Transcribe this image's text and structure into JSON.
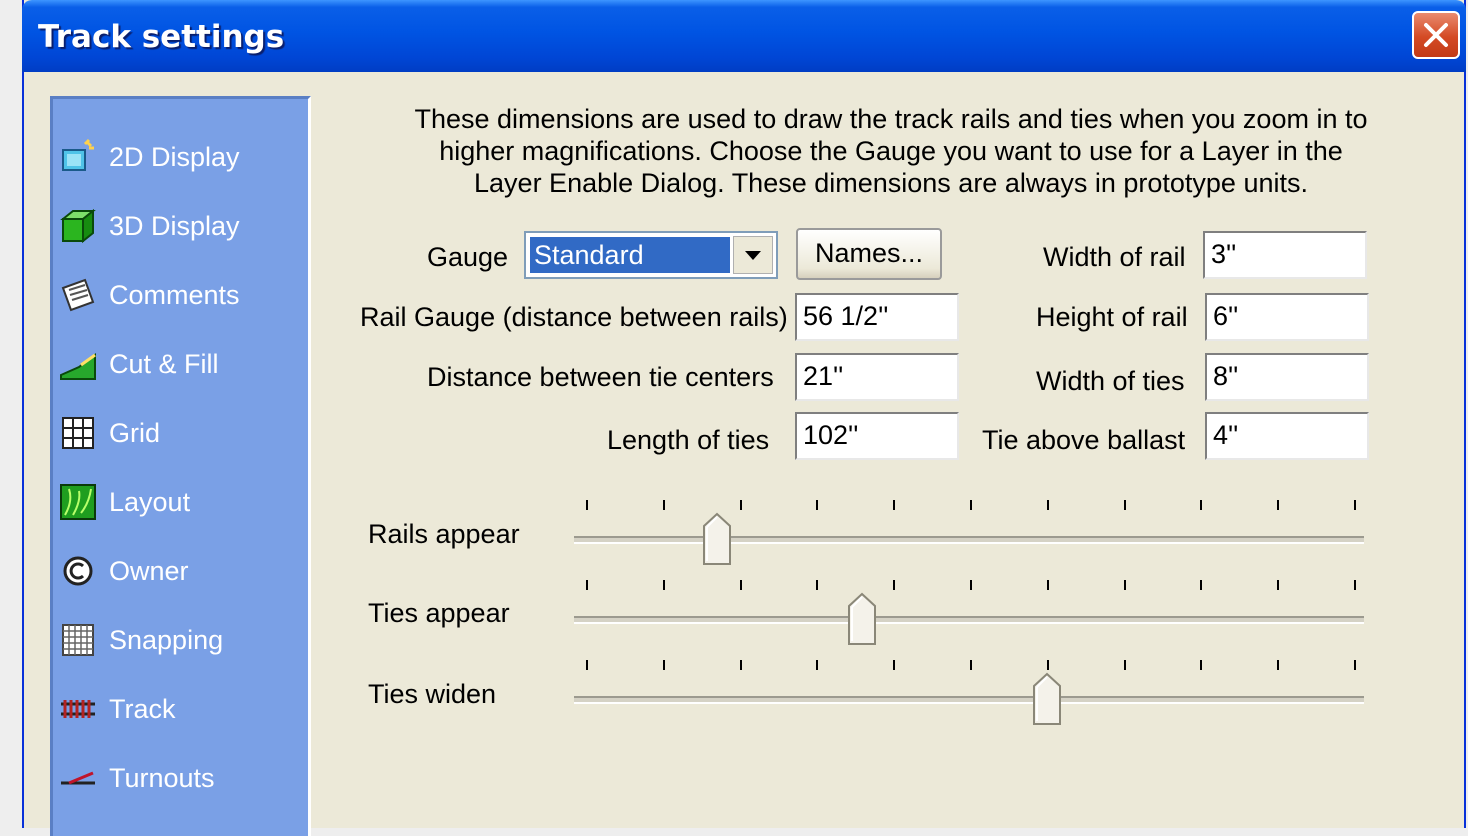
{
  "window": {
    "title": "Track settings"
  },
  "sidebar": {
    "items": [
      {
        "label": "2D Display",
        "icon": "2d-display-icon"
      },
      {
        "label": "3D Display",
        "icon": "3d-cube-icon"
      },
      {
        "label": "Comments",
        "icon": "comments-icon"
      },
      {
        "label": "Cut & Fill",
        "icon": "cut-fill-icon"
      },
      {
        "label": "Grid",
        "icon": "grid-icon"
      },
      {
        "label": "Layout",
        "icon": "layout-icon"
      },
      {
        "label": "Owner",
        "icon": "copyright-icon"
      },
      {
        "label": "Snapping",
        "icon": "snapping-icon"
      },
      {
        "label": "Track",
        "icon": "track-icon"
      },
      {
        "label": "Turnouts",
        "icon": "turnouts-icon"
      }
    ]
  },
  "description": {
    "line1": "These dimensions are used to draw the track rails and ties when you zoom in to",
    "line2": "higher magnifications. Choose the Gauge you want to use for a Layer in the",
    "line3": "Layer Enable Dialog. These dimensions are always in prototype units."
  },
  "form": {
    "gauge_label": "Gauge",
    "gauge_value": "Standard",
    "names_button": "Names...",
    "rail_gauge_label": "Rail Gauge (distance between rails)",
    "rail_gauge_value": "56 1/2''",
    "tie_distance_label": "Distance between tie centers",
    "tie_distance_value": "21''",
    "tie_length_label": "Length of ties",
    "tie_length_value": "102''",
    "rail_width_label": "Width of rail",
    "rail_width_value": "3''",
    "rail_height_label": "Height of rail",
    "rail_height_value": "6''",
    "tie_width_label": "Width of ties",
    "tie_width_value": "8''",
    "tie_above_ballast_label": "Tie above ballast",
    "tie_above_ballast_value": "4''"
  },
  "sliders": {
    "tick_count": 11,
    "rails_appear": {
      "label": "Rails appear",
      "position": 0.17
    },
    "ties_appear": {
      "label": "Ties appear",
      "position": 0.36
    },
    "ties_widen": {
      "label": "Ties widen",
      "position": 0.6
    }
  },
  "colors": {
    "titlebar": "#0054e3",
    "sidebar": "#7aa0e6",
    "dialog": "#ece9d8",
    "selection": "#316ac5",
    "close": "#d44a24"
  }
}
